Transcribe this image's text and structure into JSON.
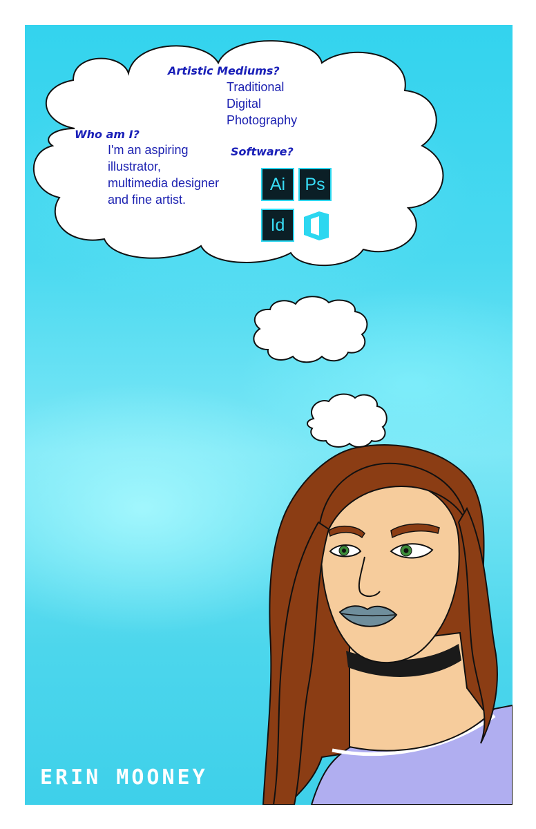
{
  "thought": {
    "mediums_question": "Artistic Mediums?",
    "mediums": [
      "Traditional",
      "Digital",
      "Photography"
    ],
    "who_question": "Who am I?",
    "who_answer": [
      "I'm an aspiring",
      "illustrator,",
      "multimedia designer",
      "and fine artist."
    ],
    "software_question": "Software?",
    "software_icons": [
      {
        "label": "Ai",
        "icon": "adobe-illustrator-icon"
      },
      {
        "label": "Ps",
        "icon": "adobe-photoshop-icon"
      },
      {
        "label": "Id",
        "icon": "adobe-indesign-icon"
      },
      {
        "label": "",
        "icon": "microsoft-office-icon"
      }
    ]
  },
  "artist_name": "ERIN MOONEY",
  "colors": {
    "sky": "#3fd4ec",
    "question_text": "#1a20b8",
    "hair": "#8b3d14",
    "skin": "#f6cc9c",
    "shirt": "#b0aef0",
    "lips": "#6f8e9c",
    "eyes": "#3c8c3a",
    "icon_bg": "#0b1f26",
    "icon_fg": "#38dcf5"
  }
}
